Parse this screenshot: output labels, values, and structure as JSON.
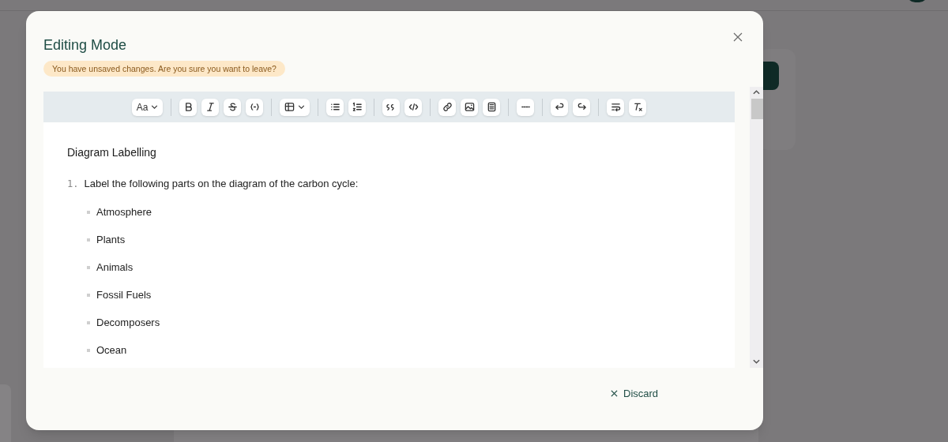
{
  "dialog": {
    "title": "Editing Mode",
    "warning": "You have unsaved changes. Are you sure you want to leave?",
    "toolbar": [
      [
        {
          "kind": "text-style",
          "label": "Aa",
          "dropdown": true
        }
      ],
      [
        {
          "kind": "bold"
        },
        {
          "kind": "italic"
        },
        {
          "kind": "strike"
        },
        {
          "kind": "inline-code"
        }
      ],
      [
        {
          "kind": "table",
          "dropdown": true
        }
      ],
      [
        {
          "kind": "bullet-list"
        },
        {
          "kind": "ordered-list"
        }
      ],
      [
        {
          "kind": "quote"
        },
        {
          "kind": "code-block"
        }
      ],
      [
        {
          "kind": "link"
        },
        {
          "kind": "image"
        },
        {
          "kind": "calculator"
        }
      ],
      [
        {
          "kind": "rule"
        }
      ],
      [
        {
          "kind": "undo"
        },
        {
          "kind": "redo"
        }
      ],
      [
        {
          "kind": "wrap"
        },
        {
          "kind": "clear-format"
        }
      ]
    ],
    "document": {
      "heading": "Diagram Labelling",
      "items": [
        {
          "number": "1.",
          "text": "Label the following parts on the diagram of the carbon cycle:",
          "children": [
            {
              "text": "Atmosphere"
            },
            {
              "text": "Plants"
            },
            {
              "text": "Animals"
            },
            {
              "text": "Fossil Fuels"
            },
            {
              "text": "Decomposers"
            },
            {
              "text": "Ocean"
            }
          ]
        }
      ]
    },
    "discard_label": "Discard"
  }
}
